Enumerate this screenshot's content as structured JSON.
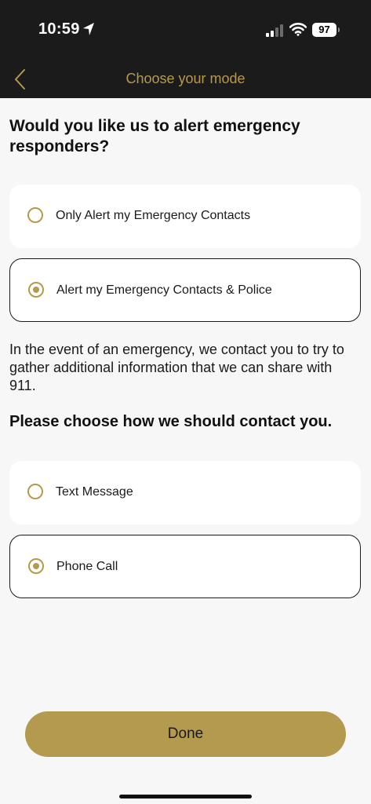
{
  "status_bar": {
    "time": "10:59",
    "battery": "97"
  },
  "nav": {
    "title": "Choose your mode",
    "back_icon": "chevron-left-icon"
  },
  "alert_section": {
    "question": "Would you like us to alert emergency responders?",
    "options": [
      {
        "label": "Only Alert my Emergency Contacts",
        "selected": false
      },
      {
        "label": "Alert my Emergency Contacts & Police",
        "selected": true
      }
    ]
  },
  "info_text": "In the event of an emergency, we contact you to try to gather additional information that we can share with 911.",
  "contact_section": {
    "question": "Please choose how we should contact you.",
    "options": [
      {
        "label": "Text Message",
        "selected": false
      },
      {
        "label": "Phone Call",
        "selected": true
      }
    ]
  },
  "done_button": {
    "label": "Done"
  },
  "colors": {
    "accent": "#b59a4d",
    "header_bg": "#1b1b1b",
    "page_bg": "#f7f7f7",
    "button_bg": "#b39a4e"
  }
}
